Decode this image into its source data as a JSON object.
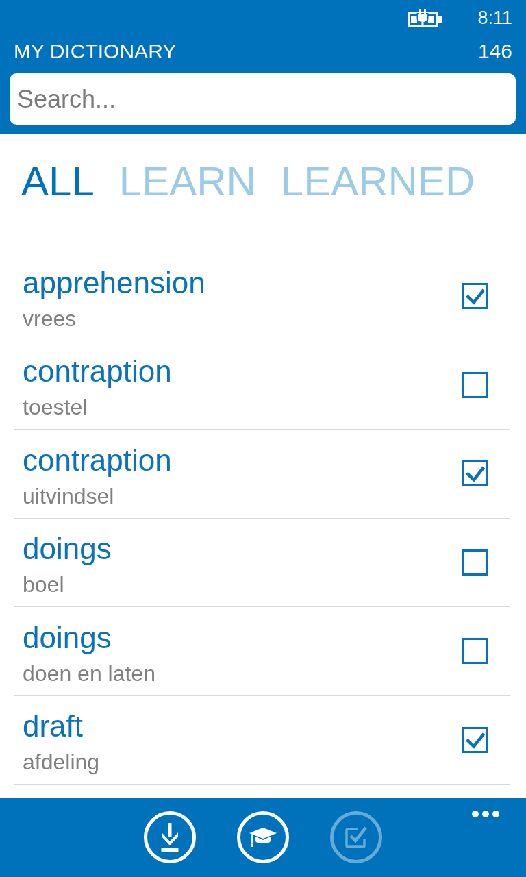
{
  "status_bar": {
    "time": "8:11"
  },
  "header": {
    "title": "MY DICTIONARY",
    "count": "146"
  },
  "search": {
    "placeholder": "Search..."
  },
  "pivot": [
    {
      "label": "ALL",
      "selected": true
    },
    {
      "label": "LEARN",
      "selected": false
    },
    {
      "label": "LEARNED",
      "selected": false
    }
  ],
  "list": {
    "items": [
      {
        "word": "apprehension",
        "translation": "vrees",
        "checked": true
      },
      {
        "word": "contraption",
        "translation": "toestel",
        "checked": false
      },
      {
        "word": "contraption",
        "translation": "uitvindsel",
        "checked": true
      },
      {
        "word": "doings",
        "translation": "boel",
        "checked": false
      },
      {
        "word": "doings",
        "translation": "doen en laten",
        "checked": false
      },
      {
        "word": "draft",
        "translation": "afdeling",
        "checked": true
      }
    ]
  },
  "app_bar": {
    "buttons": [
      {
        "kind": "download",
        "disabled": false
      },
      {
        "kind": "study",
        "disabled": false
      },
      {
        "kind": "mark-learned",
        "disabled": true
      }
    ]
  }
}
